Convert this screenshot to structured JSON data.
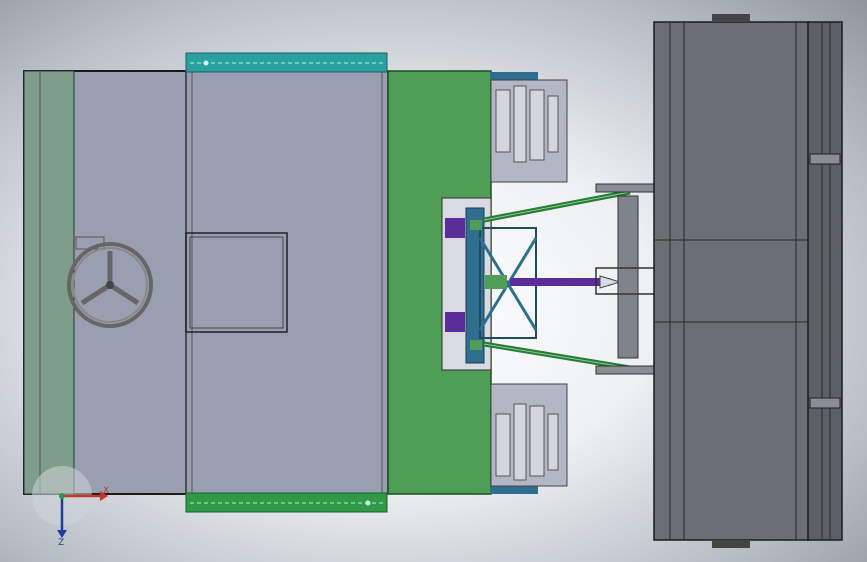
{
  "viewport": {
    "view_name": "",
    "triad": {
      "x_label": "X",
      "z_label": "Z"
    }
  },
  "colors": {
    "body_fill": "#9a9eb1",
    "panel_green": "#4e9e55",
    "rail_teal": "#2aa0a0",
    "rail_green": "#2e9a46",
    "mechanism_blue": "#2f6e8e",
    "accent_purple": "#5a2d9a",
    "rotor_fill": "#6b6e75",
    "track_fill": "#b3b6c4"
  },
  "icons": {
    "steering_wheel": "steering-wheel-icon",
    "triad": "coordinate-triad-icon"
  }
}
